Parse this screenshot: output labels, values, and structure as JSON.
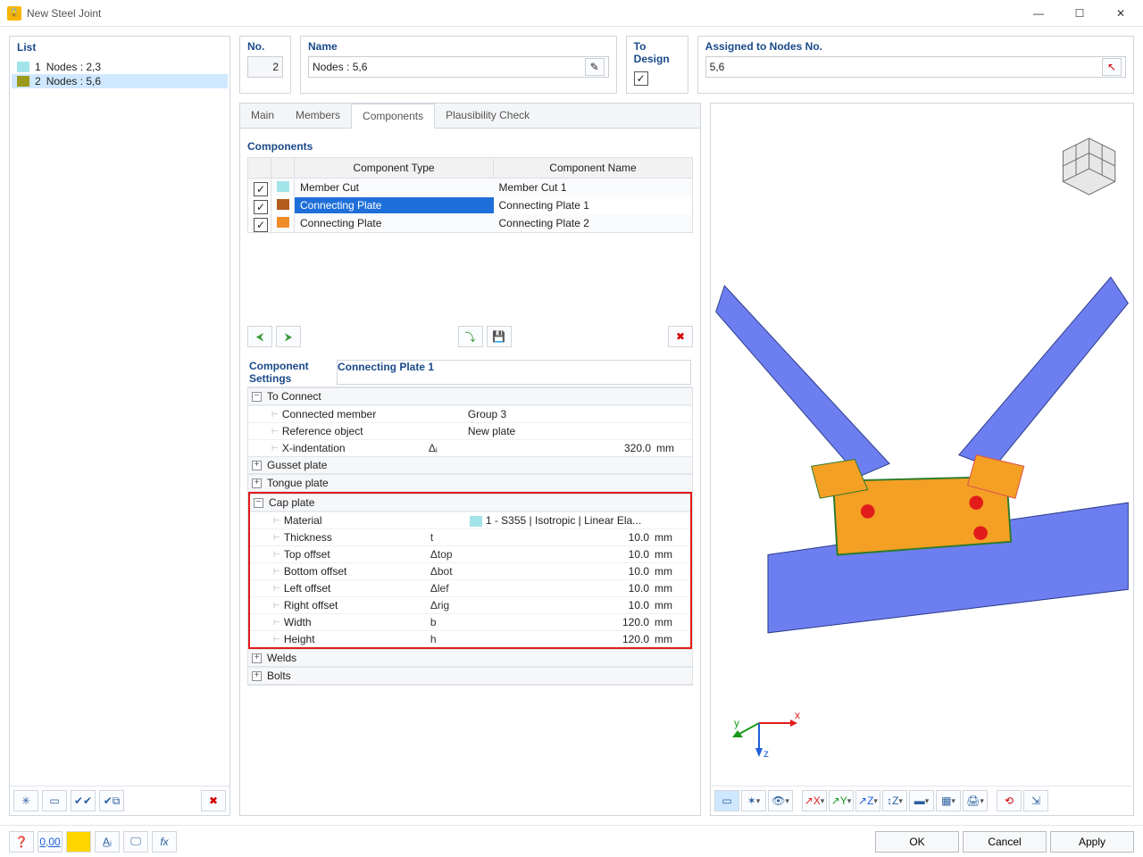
{
  "window": {
    "title": "New Steel Joint"
  },
  "list": {
    "header": "List",
    "items": [
      {
        "num": "1",
        "label": "Nodes : 2,3",
        "swatch": "#a2e4ea"
      },
      {
        "num": "2",
        "label": "Nodes : 5,6",
        "swatch": "#9a9a1c"
      }
    ],
    "selected": 1
  },
  "fields": {
    "no_label": "No.",
    "no_value": "2",
    "name_label": "Name",
    "name_value": "Nodes : 5,6",
    "design_label": "To Design",
    "design_checked": true,
    "assigned_label": "Assigned to Nodes No.",
    "assigned_value": "5,6"
  },
  "tabs": [
    "Main",
    "Members",
    "Components",
    "Plausibility Check"
  ],
  "tabs_active": 2,
  "components": {
    "header": "Components",
    "col_type": "Component Type",
    "col_name": "Component Name",
    "rows": [
      {
        "type": "Member Cut",
        "name": "Member Cut 1",
        "swatch": "#a2e4ea"
      },
      {
        "type": "Connecting Plate",
        "name": "Connecting Plate 1",
        "swatch": "#b35c1e"
      },
      {
        "type": "Connecting Plate",
        "name": "Connecting Plate 2",
        "swatch": "#f08c28"
      }
    ],
    "selected": 1
  },
  "settings": {
    "left_header": "Component Settings",
    "right_header": "Connecting Plate 1",
    "sections": {
      "to_connect": {
        "title": "To Connect",
        "rows": [
          {
            "label": "Connected member",
            "sym": "",
            "val": "Group 3",
            "unit": ""
          },
          {
            "label": "Reference object",
            "sym": "",
            "val": "New plate",
            "unit": ""
          },
          {
            "label": "X-indentation",
            "sym": "Δᵢ",
            "val": "320.0",
            "unit": "mm"
          }
        ]
      },
      "gusset": {
        "title": "Gusset plate"
      },
      "tongue": {
        "title": "Tongue plate"
      },
      "cap": {
        "title": "Cap plate",
        "rows": [
          {
            "label": "Material",
            "sym": "",
            "val": "1 - S355 | Isotropic | Linear Ela...",
            "unit": "",
            "swatch": true
          },
          {
            "label": "Thickness",
            "sym": "t",
            "val": "10.0",
            "unit": "mm"
          },
          {
            "label": "Top offset",
            "sym": "Δtop",
            "val": "10.0",
            "unit": "mm"
          },
          {
            "label": "Bottom offset",
            "sym": "Δbot",
            "val": "10.0",
            "unit": "mm"
          },
          {
            "label": "Left offset",
            "sym": "Δlef",
            "val": "10.0",
            "unit": "mm"
          },
          {
            "label": "Right offset",
            "sym": "Δrig",
            "val": "10.0",
            "unit": "mm"
          },
          {
            "label": "Width",
            "sym": "b",
            "val": "120.0",
            "unit": "mm"
          },
          {
            "label": "Height",
            "sym": "h",
            "val": "120.0",
            "unit": "mm"
          }
        ]
      },
      "welds": {
        "title": "Welds"
      },
      "bolts": {
        "title": "Bolts"
      }
    }
  },
  "axis": {
    "x": "x",
    "y": "y",
    "z": "z"
  },
  "buttons": {
    "ok": "OK",
    "cancel": "Cancel",
    "apply": "Apply"
  }
}
